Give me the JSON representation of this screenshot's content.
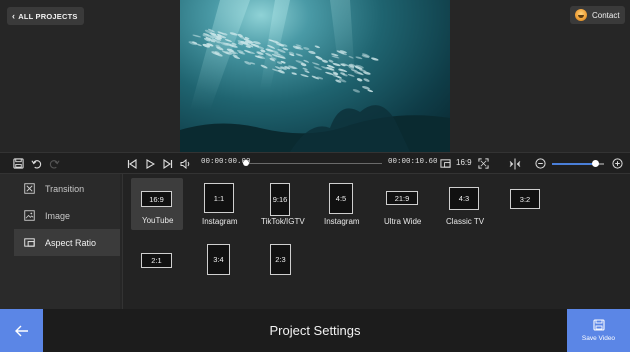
{
  "header": {
    "all_projects_label": "ALL PROJECTS",
    "contact_label": "Contact"
  },
  "timeline": {
    "current_time": "00:00:00.00",
    "total_time": "00:00:10.60",
    "ratio": "16:9",
    "progress": 0.0,
    "zoom_level": 0.85
  },
  "sidebar": {
    "items": [
      {
        "label": "Transition",
        "icon": "transition-icon"
      },
      {
        "label": "Image",
        "icon": "image-icon"
      },
      {
        "label": "Aspect Ratio",
        "icon": "aspect-ratio-icon",
        "active": true
      }
    ]
  },
  "ratios": [
    {
      "ratio": "16:9",
      "label": "YouTube",
      "selected": true
    },
    {
      "ratio": "1:1",
      "label": "Instagram"
    },
    {
      "ratio": "9:16",
      "label": "TikTok/IGTV"
    },
    {
      "ratio": "4:5",
      "label": "Instagram"
    },
    {
      "ratio": "21:9",
      "label": "Ultra Wide"
    },
    {
      "ratio": "4:3",
      "label": "Classic TV"
    },
    {
      "ratio": "3:2",
      "label": ""
    },
    {
      "ratio": "2:1",
      "label": ""
    },
    {
      "ratio": "3:4",
      "label": ""
    },
    {
      "ratio": "2:3",
      "label": ""
    }
  ],
  "footer": {
    "title": "Project Settings",
    "save_label": "Save Video"
  },
  "colors": {
    "accent": "#5b86e6",
    "background": "#262626"
  }
}
